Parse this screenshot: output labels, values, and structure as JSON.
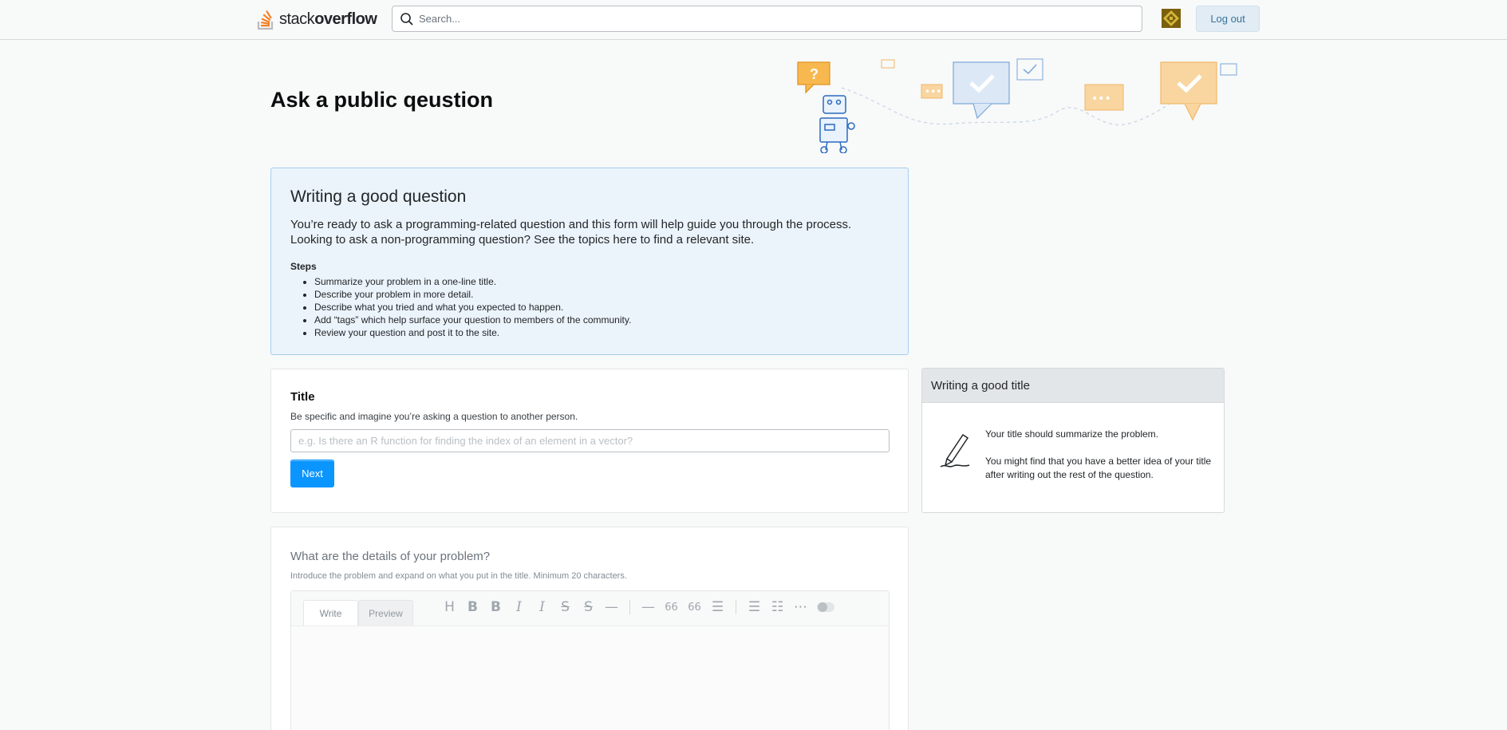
{
  "header": {
    "logo_text_light": "stack",
    "logo_text_bold": "overflow",
    "search_placeholder": "Search...",
    "logout_label": "Log out"
  },
  "page": {
    "title": "Ask a public qeustion"
  },
  "infobox": {
    "heading": "Writing a good question",
    "line1": "You’re ready to ask a programming-related question and this form will help guide you through the process.",
    "line2": "Looking to ask a non-programming question? See the topics here to find a relevant site.",
    "steps_label": "Steps",
    "steps": [
      "Summarize your problem in a one-line title.",
      "Describe your problem in more detail.",
      "Describe what you tried and what you expected to happen.",
      "Add “tags” which help surface your question to members of the community.",
      "Review your question and post it to the site."
    ]
  },
  "title_section": {
    "label": "Title",
    "description": "Be specific and imagine you’re asking a question to another person.",
    "placeholder": "e.g. Is there an R function for finding the index of an element in a vector?",
    "next_label": "Next"
  },
  "side_panel": {
    "heading": "Writing a good title",
    "para1": "Your title should summarize the problem.",
    "para2": "You might find that you have a better idea of your title after writing out the rest of the question."
  },
  "details_section": {
    "label": "What are the details of your problem?",
    "description": "Introduce the problem and expand on what you put in the title. Minimum 20 characters.",
    "tab_write": "Write",
    "tab_preview": "Preview"
  },
  "toolbar_icons": [
    "heading-icon",
    "bold-icon",
    "bold-alt-icon",
    "italic-icon",
    "italic-alt-icon",
    "strikethrough-icon",
    "strikethrough-alt-icon",
    "horizontal-rule-icon",
    "rule-icon",
    "quote-icon",
    "quote-alt-icon",
    "bullet-list-icon",
    "bullet-list-alt-icon",
    "numbered-list-icon",
    "more-icon",
    "preview-toggle"
  ],
  "colors": {
    "accent": "#0a95ff",
    "logo_orange": "#f48024",
    "info_bg": "#ebf4fb",
    "info_border": "#a6ceed"
  }
}
